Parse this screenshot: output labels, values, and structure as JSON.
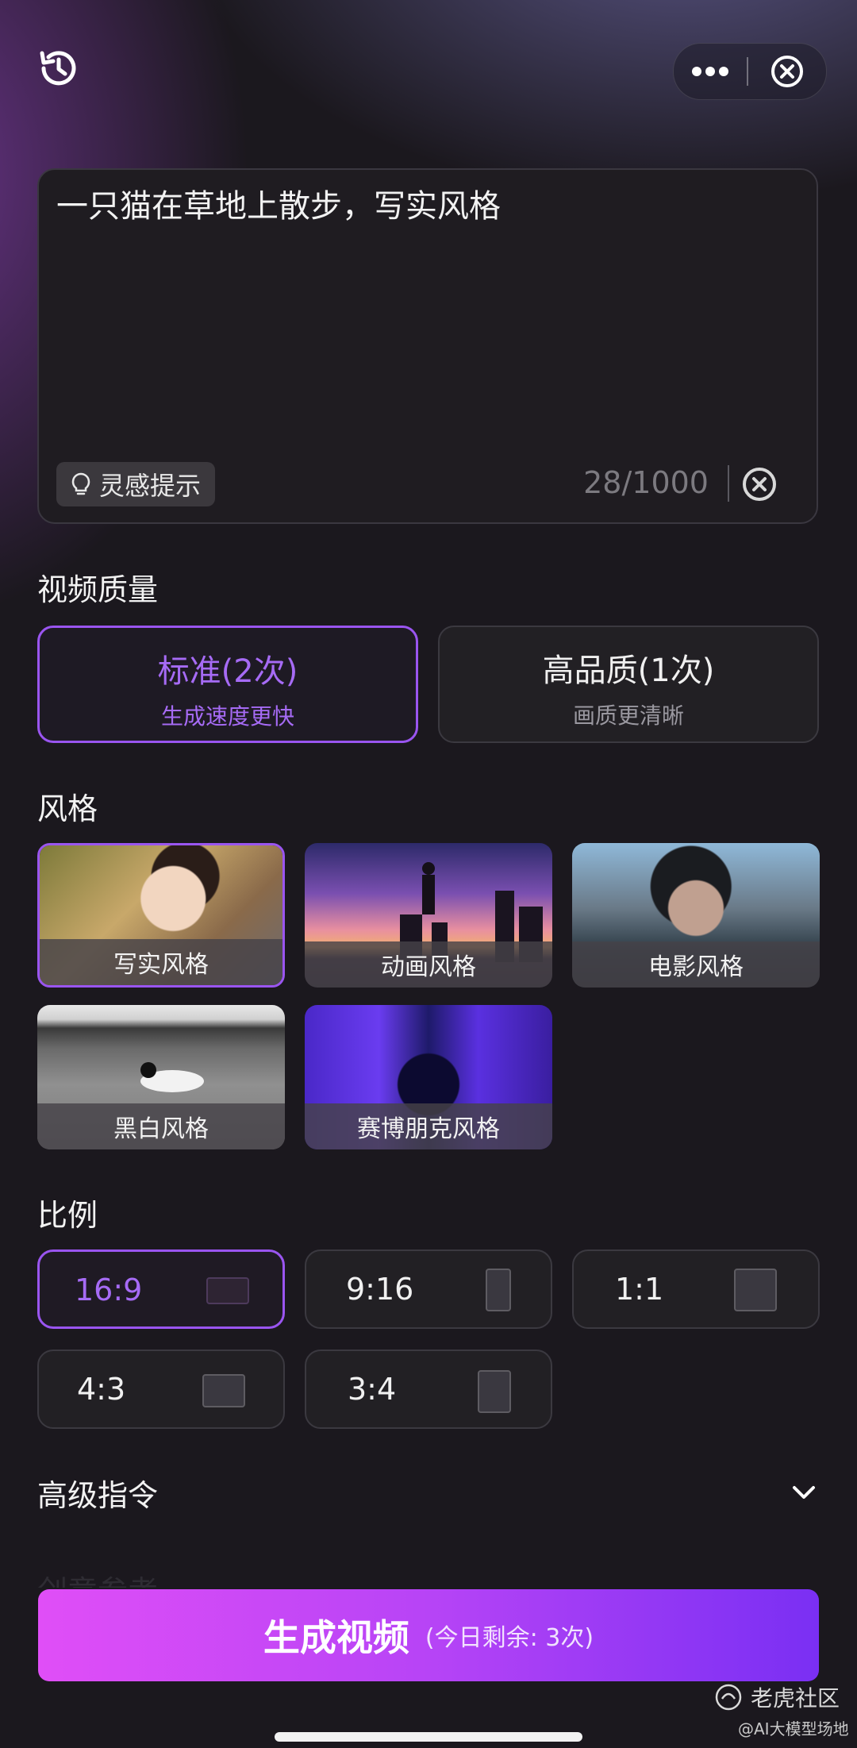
{
  "header": {
    "history_icon": "history-clock-icon",
    "more_icon": "more-dots-icon",
    "close_icon": "close-circle-icon"
  },
  "prompt": {
    "text": "一只猫在草地上散步，写实风格",
    "hint_label": "灵感提示",
    "hint_icon": "lightbulb-icon",
    "counter": "28/1000",
    "clear_icon": "clear-circle-icon"
  },
  "quality": {
    "title": "视频质量",
    "options": [
      {
        "label": "标准(2次)",
        "desc": "生成速度更快",
        "selected": true
      },
      {
        "label": "高品质(1次)",
        "desc": "画质更清晰",
        "selected": false
      }
    ]
  },
  "style": {
    "title": "风格",
    "options": [
      {
        "label": "写实风格",
        "selected": true
      },
      {
        "label": "动画风格",
        "selected": false
      },
      {
        "label": "电影风格",
        "selected": false
      },
      {
        "label": "黑白风格",
        "selected": false
      },
      {
        "label": "赛博朋克风格",
        "selected": false
      }
    ]
  },
  "ratio": {
    "title": "比例",
    "options": [
      {
        "label": "16:9",
        "selected": true
      },
      {
        "label": "9:16",
        "selected": false
      },
      {
        "label": "1:1",
        "selected": false
      },
      {
        "label": "4:3",
        "selected": false
      },
      {
        "label": "3:4",
        "selected": false
      }
    ]
  },
  "advanced": {
    "title": "高级指令",
    "chevron_icon": "chevron-down-icon",
    "faded_text": "创意参考"
  },
  "generate": {
    "label": "生成视频",
    "remaining": "(今日剩余: 3次)"
  },
  "watermark": {
    "name": "老虎社区",
    "handle": "@AI大模型场地"
  },
  "colors": {
    "accent": "#9a55f0",
    "button_gradient_start": "#e04ef7",
    "button_gradient_end": "#7a2ff3"
  }
}
